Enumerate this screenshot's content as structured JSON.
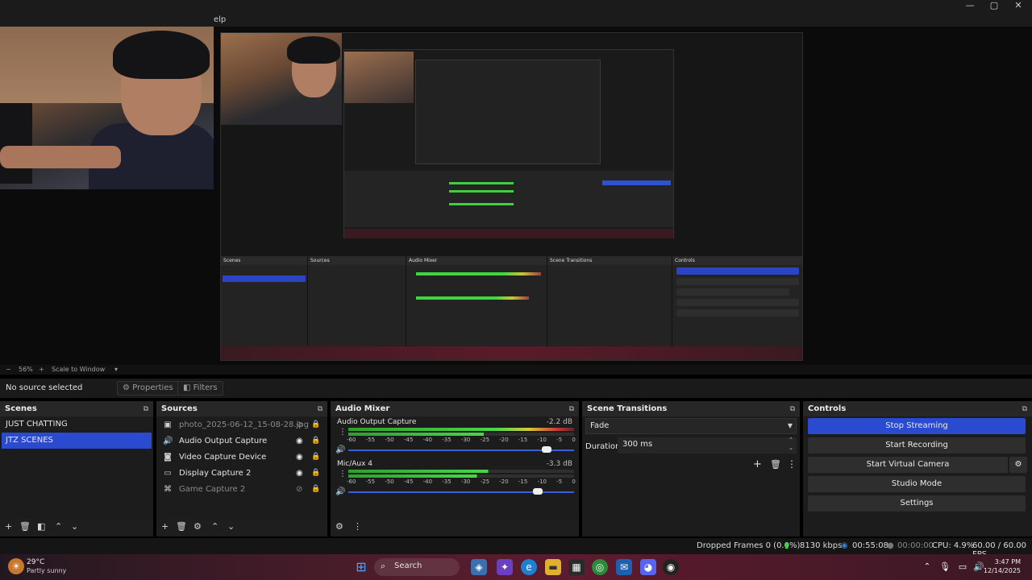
{
  "menu_fragment": "elp",
  "window_controls": {
    "minimize": "—",
    "maximize": "▢",
    "close": "✕"
  },
  "preview_bar": {
    "zoom": "56%",
    "scale_mode": "Scale to Window"
  },
  "source_toolbar": {
    "no_source": "No source selected",
    "properties": "Properties",
    "filters": "Filters"
  },
  "docks": {
    "scenes": {
      "title": "Scenes",
      "items": [
        "JUST CHATTING",
        "JTZ SCENES"
      ],
      "active_index": 1
    },
    "sources": {
      "title": "Sources",
      "items": [
        {
          "label": "photo_2025-06-12_15-08-28.jpg",
          "icon": "image-icon",
          "visible": false
        },
        {
          "label": "Audio Output Capture",
          "icon": "speaker-icon",
          "visible": true
        },
        {
          "label": "Video Capture Device",
          "icon": "camera-icon",
          "visible": true
        },
        {
          "label": "Display Capture 2",
          "icon": "monitor-icon",
          "visible": true
        },
        {
          "label": "Game Capture 2",
          "icon": "gamepad-icon",
          "visible": false
        }
      ]
    },
    "audio_mixer": {
      "title": "Audio Mixer",
      "scale": [
        "-60",
        "-55",
        "-50",
        "-45",
        "-40",
        "-35",
        "-30",
        "-25",
        "-20",
        "-15",
        "-10",
        "-5",
        "0"
      ],
      "channels": [
        {
          "name": "Audio Output Capture",
          "db": "-2.2 dB",
          "volume": 0.88
        },
        {
          "name": "Mic/Aux 4",
          "db": "-3.3 dB",
          "volume": 0.84
        }
      ]
    },
    "scene_transitions": {
      "title": "Scene Transitions",
      "transition": "Fade",
      "duration_label": "Duration",
      "duration_value": "300 ms"
    },
    "controls": {
      "title": "Controls",
      "buttons": [
        "Stop Streaming",
        "Start Recording",
        "Start Virtual Camera",
        "Studio Mode",
        "Settings"
      ]
    }
  },
  "status": {
    "dropped_frames": "Dropped Frames 0 (0.0%)",
    "bitrate": "8130 kbps",
    "stream_time": "00:55:08",
    "record_time": "00:00:00",
    "cpu": "CPU: 4.9%",
    "fps": "60.00 / 60.00 FPS"
  },
  "taskbar": {
    "weather_temp": "29°C",
    "weather_desc": "Partly sunny",
    "search_label": "Search",
    "time": "3:47 PM",
    "date": "12/14/2025"
  },
  "colors": {
    "accent": "#2a4bd0",
    "panel": "#1e1e1e",
    "header": "#272727"
  }
}
